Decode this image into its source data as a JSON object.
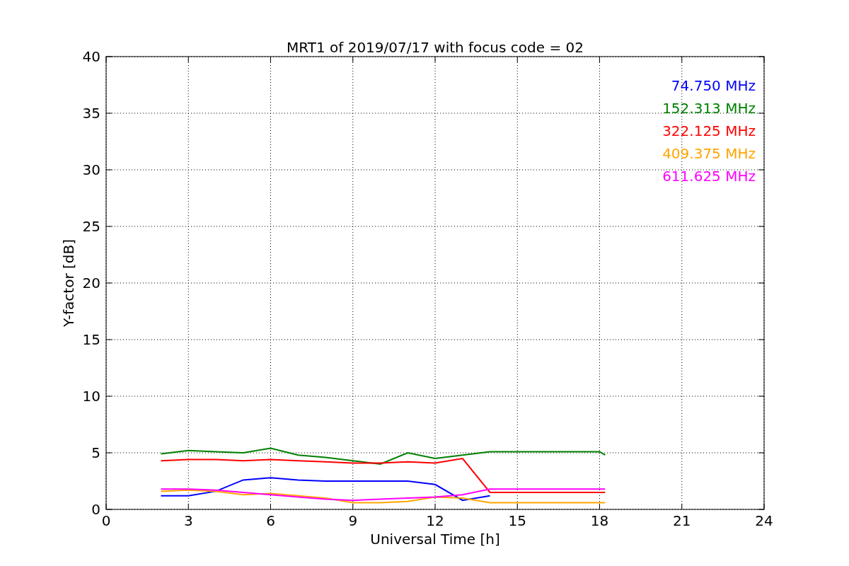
{
  "figure": {
    "chart_data": {
      "type": "line",
      "title": "MRT1 of 2019/07/17 with focus code = 02",
      "xlabel": "Universal Time [h]",
      "ylabel": "Y-factor [dB]",
      "x": [
        2,
        3,
        4,
        5,
        6,
        7,
        8,
        9,
        10,
        11,
        12,
        13,
        14,
        18,
        18.2
      ],
      "series": [
        {
          "name": "74.750 MHz",
          "color": "#0000ff",
          "values": [
            1.2,
            1.2,
            1.6,
            2.6,
            2.8,
            2.6,
            2.5,
            2.5,
            2.5,
            2.5,
            2.2,
            0.8,
            1.2,
            null,
            null
          ]
        },
        {
          "name": "152.313 MHz",
          "color": "#008000",
          "values": [
            4.9,
            5.2,
            5.1,
            5.0,
            5.4,
            4.8,
            4.6,
            4.3,
            4.0,
            5.0,
            4.5,
            4.8,
            5.1,
            5.1,
            4.8
          ]
        },
        {
          "name": "322.125 MHz",
          "color": "#ff0000",
          "values": [
            4.3,
            4.4,
            4.4,
            4.3,
            4.4,
            4.3,
            4.2,
            4.1,
            4.1,
            4.2,
            4.1,
            4.5,
            1.5,
            1.5,
            1.5
          ]
        },
        {
          "name": "409.375 MHz",
          "color": "#ffa500",
          "values": [
            1.6,
            1.7,
            1.6,
            1.3,
            1.4,
            1.2,
            1.0,
            0.6,
            0.6,
            0.7,
            1.1,
            1.0,
            0.6,
            0.6,
            0.6
          ]
        },
        {
          "name": "611.625 MHz",
          "color": "#ff00ff",
          "values": [
            1.8,
            1.8,
            1.7,
            1.5,
            1.3,
            1.1,
            0.9,
            0.8,
            0.9,
            1.0,
            1.1,
            1.3,
            1.8,
            1.8,
            1.8
          ]
        }
      ],
      "grid": true,
      "xlim": [
        0,
        24
      ],
      "ylim": [
        0,
        40
      ],
      "xticks": [
        0,
        3,
        6,
        9,
        12,
        15,
        18,
        21,
        24
      ],
      "yticks": [
        0,
        5,
        10,
        15,
        20,
        25,
        30,
        35,
        40
      ]
    }
  }
}
